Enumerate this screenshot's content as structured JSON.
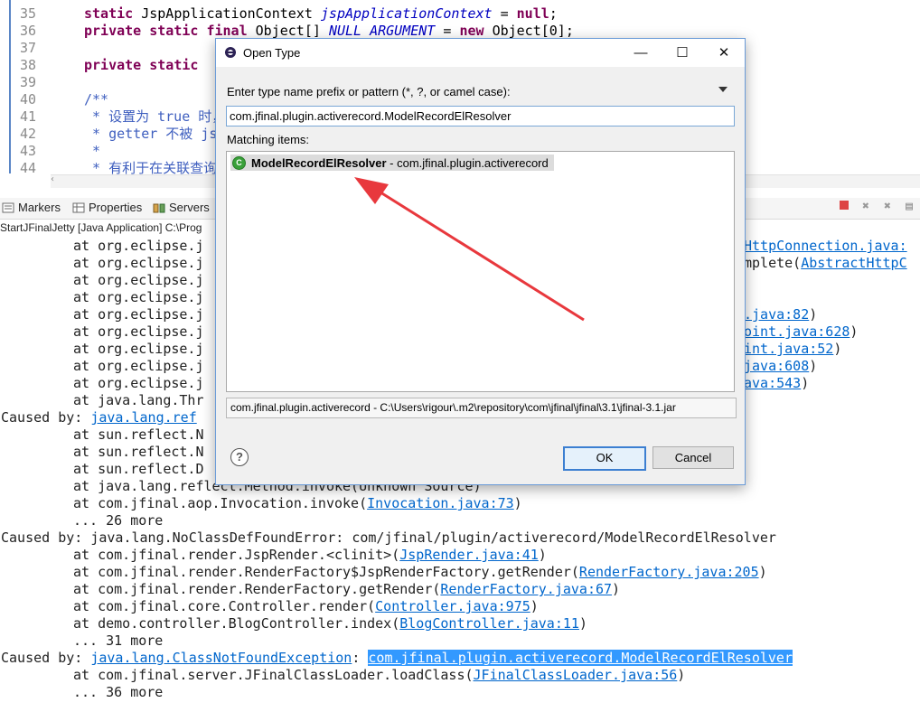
{
  "editor": {
    "line_numbers": [
      "35",
      "36",
      "37",
      "38",
      "39",
      "40",
      "41",
      "42",
      "43",
      "44"
    ],
    "lines": [
      {
        "num": "35",
        "parts": [
          {
            "t": "static ",
            "c": "kw"
          },
          {
            "t": "JspApplicationContext ",
            "c": ""
          },
          {
            "t": "jspApplicationContext",
            "c": "it"
          },
          {
            "t": " = ",
            "c": ""
          },
          {
            "t": "null",
            "c": "kw"
          },
          {
            "t": ";",
            "c": ""
          }
        ]
      },
      {
        "num": "36",
        "parts": [
          {
            "t": "private static final ",
            "c": "kw"
          },
          {
            "t": "Object[] ",
            "c": ""
          },
          {
            "t": "NULL_ARGUMENT",
            "c": "it"
          },
          {
            "t": " = ",
            "c": ""
          },
          {
            "t": "new ",
            "c": "kw"
          },
          {
            "t": "Object[0];",
            "c": ""
          }
        ]
      },
      {
        "num": "37",
        "parts": []
      },
      {
        "num": "38",
        "parts": [
          {
            "t": "private static",
            "c": "kw"
          }
        ]
      },
      {
        "num": "39",
        "parts": []
      },
      {
        "num": "40",
        "parts": [
          {
            "t": "/**",
            "c": "cm"
          }
        ]
      },
      {
        "num": "41",
        "parts": [
          {
            "t": " * 设置为 true 时，",
            "c": "cm"
          }
        ]
      },
      {
        "num": "42",
        "parts": [
          {
            "t": " * getter 不被 js",
            "c": "cm"
          }
        ]
      },
      {
        "num": "43",
        "parts": [
          {
            "t": " *",
            "c": "cm"
          }
        ]
      },
      {
        "num": "44",
        "parts": [
          {
            "t": " * 有利于在关联查询时编",
            "c": "cm"
          }
        ]
      }
    ]
  },
  "view_tabs": {
    "markers": "Markers",
    "properties": "Properties",
    "servers": "Servers"
  },
  "console_title": "StartJFinalJetty [Java Application] C:\\Prog",
  "console": {
    "lines": [
      {
        "indent": true,
        "left": "at org.eclipse.j",
        "right": [
          {
            "t": "HttpConnection.java:",
            "c": "link"
          }
        ]
      },
      {
        "indent": true,
        "left": "at org.eclipse.j",
        "right": [
          {
            "t": "mplete(",
            "c": ""
          },
          {
            "t": "AbstractHttpC",
            "c": "link"
          }
        ]
      },
      {
        "indent": true,
        "left": "at org.eclipse.j",
        "right": []
      },
      {
        "indent": true,
        "left": "at org.eclipse.j",
        "right": []
      },
      {
        "indent": true,
        "left": "at org.eclipse.j",
        "right": [
          {
            "t": ".java:82",
            "c": "link"
          },
          {
            "t": ")",
            "c": ""
          }
        ]
      },
      {
        "indent": true,
        "left": "at org.eclipse.j",
        "right": [
          {
            "t": "oint.java:628",
            "c": "link"
          },
          {
            "t": ")",
            "c": ""
          }
        ]
      },
      {
        "indent": true,
        "left": "at org.eclipse.j",
        "right": [
          {
            "t": "int.java:52",
            "c": "link"
          },
          {
            "t": ")",
            "c": ""
          }
        ]
      },
      {
        "indent": true,
        "left": "at org.eclipse.j",
        "right": [
          {
            "t": "java:608",
            "c": "link"
          },
          {
            "t": ")",
            "c": ""
          }
        ]
      },
      {
        "indent": true,
        "left": "at org.eclipse.j",
        "right": [
          {
            "t": "ava:543",
            "c": "link"
          },
          {
            "t": ")",
            "c": ""
          }
        ]
      },
      {
        "indent": true,
        "left": "at java.lang.Thr",
        "right": []
      },
      {
        "indent": false,
        "parts": [
          {
            "t": "Caused by: ",
            "c": ""
          },
          {
            "t": "java.lang.ref",
            "c": "link"
          }
        ]
      },
      {
        "indent": true,
        "left": "at sun.reflect.N",
        "right": []
      },
      {
        "indent": true,
        "left": "at sun.reflect.N",
        "right": []
      },
      {
        "indent": true,
        "left": "at sun.reflect.D",
        "right": []
      },
      {
        "indent": true,
        "parts": [
          {
            "t": "at java.lang.reflect.Method.invoke(Unknown Source)",
            "c": ""
          }
        ]
      },
      {
        "indent": true,
        "parts": [
          {
            "t": "at com.jfinal.aop.Invocation.invoke(",
            "c": ""
          },
          {
            "t": "Invocation.java:73",
            "c": "link"
          },
          {
            "t": ")",
            "c": ""
          }
        ]
      },
      {
        "indent": true,
        "parts": [
          {
            "t": "... 26 more",
            "c": ""
          }
        ]
      },
      {
        "indent": false,
        "parts": [
          {
            "t": "Caused by: java.lang.NoClassDefFoundError: com/jfinal/plugin/activerecord/ModelRecordElResolver",
            "c": ""
          }
        ]
      },
      {
        "indent": true,
        "parts": [
          {
            "t": "at com.jfinal.render.JspRender.<clinit>(",
            "c": ""
          },
          {
            "t": "JspRender.java:41",
            "c": "link"
          },
          {
            "t": ")",
            "c": ""
          }
        ]
      },
      {
        "indent": true,
        "parts": [
          {
            "t": "at com.jfinal.render.RenderFactory$JspRenderFactory.getRender(",
            "c": ""
          },
          {
            "t": "RenderFactory.java:205",
            "c": "link"
          },
          {
            "t": ")",
            "c": ""
          }
        ]
      },
      {
        "indent": true,
        "parts": [
          {
            "t": "at com.jfinal.render.RenderFactory.getRender(",
            "c": ""
          },
          {
            "t": "RenderFactory.java:67",
            "c": "link"
          },
          {
            "t": ")",
            "c": ""
          }
        ]
      },
      {
        "indent": true,
        "parts": [
          {
            "t": "at com.jfinal.core.Controller.render(",
            "c": ""
          },
          {
            "t": "Controller.java:975",
            "c": "link"
          },
          {
            "t": ")",
            "c": ""
          }
        ]
      },
      {
        "indent": true,
        "parts": [
          {
            "t": "at demo.controller.BlogController.index(",
            "c": ""
          },
          {
            "t": "BlogController.java:11",
            "c": "link"
          },
          {
            "t": ")",
            "c": ""
          }
        ]
      },
      {
        "indent": true,
        "parts": [
          {
            "t": "... 31 more",
            "c": ""
          }
        ]
      },
      {
        "indent": false,
        "parts": [
          {
            "t": "Caused by: ",
            "c": ""
          },
          {
            "t": "java.lang.ClassNotFoundException",
            "c": "link"
          },
          {
            "t": ": ",
            "c": ""
          },
          {
            "t": "com.jfinal.plugin.activerecord.ModelRecordElResolver",
            "c": "sel"
          }
        ]
      },
      {
        "indent": true,
        "parts": [
          {
            "t": "at com.jfinal.server.JFinalClassLoader.loadClass(",
            "c": ""
          },
          {
            "t": "JFinalClassLoader.java:56",
            "c": "link"
          },
          {
            "t": ")",
            "c": ""
          }
        ]
      },
      {
        "indent": true,
        "parts": [
          {
            "t": "... 36 more",
            "c": ""
          }
        ]
      }
    ]
  },
  "dialog": {
    "title": "Open Type",
    "minimize": "—",
    "maximize": "☐",
    "close": "✕",
    "prompt": "Enter type name prefix or pattern (*, ?, or camel case):",
    "input_value": "com.jfinal.plugin.activerecord.ModelRecordElResolver",
    "matching_label": "Matching items:",
    "match_name": "ModelRecordElResolver",
    "match_package": " - com.jfinal.plugin.activerecord",
    "status": "com.jfinal.plugin.activerecord - C:\\Users\\rigour\\.m2\\repository\\com\\jfinal\\jfinal\\3.1\\jfinal-3.1.jar",
    "help": "?",
    "ok": "OK",
    "cancel": "Cancel"
  },
  "colors": {
    "annotation_arrow": "#e8383d",
    "link": "#0066cc",
    "selection": "#3399ff"
  },
  "icons": [
    "class-icon",
    "help-icon",
    "markers-icon",
    "properties-icon",
    "servers-icon",
    "terminate-icon",
    "remove-launch-icon",
    "clear-console-icon"
  ]
}
